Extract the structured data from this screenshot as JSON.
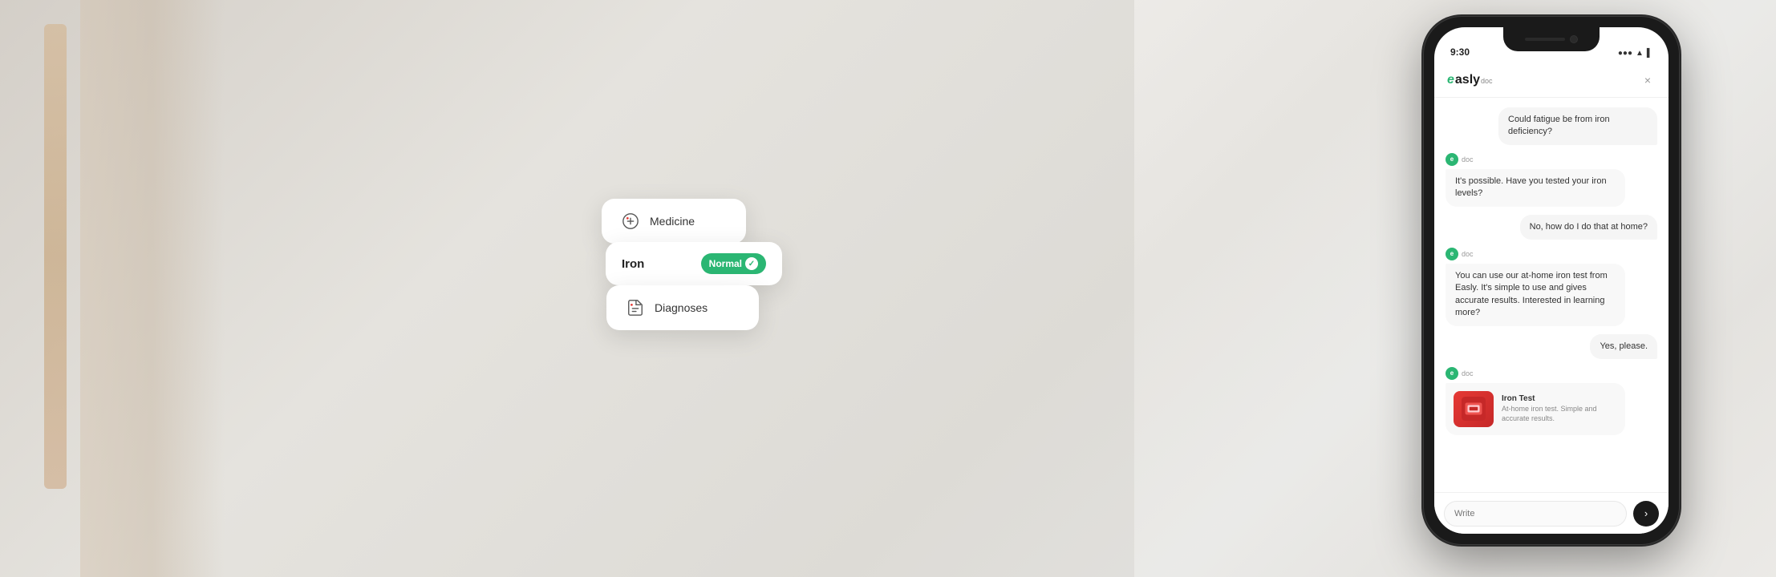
{
  "app": {
    "title": "easly.doc",
    "logo_e": "e",
    "logo_rest": "asly",
    "logo_doc": "doc",
    "close_label": "×"
  },
  "status_bar": {
    "time": "9:30",
    "signal": "●●●",
    "wifi": "▲",
    "battery": "▌"
  },
  "chat": {
    "messages": [
      {
        "type": "user",
        "text": "Could fatigue be from iron deficiency?"
      },
      {
        "type": "bot",
        "sender": "doc",
        "text": "It's possible. Have you tested your iron levels?"
      },
      {
        "type": "user",
        "text": "No, how do I do that at home?"
      },
      {
        "type": "bot",
        "sender": "doc",
        "text": "You can use our at-home iron test from Easly. It's simple to use and gives accurate results. Interested in learning more?"
      },
      {
        "type": "user",
        "text": "Yes, please."
      },
      {
        "type": "bot_product",
        "sender": "doc",
        "product_name": "Iron Test",
        "product_desc": "At-home iron test. Simple and accurate results."
      }
    ],
    "input_placeholder": "Write",
    "send_icon": "›"
  },
  "floating_cards": {
    "medicine": {
      "label": "Medicine",
      "icon": "⚕"
    },
    "iron": {
      "label": "Iron",
      "status": "Normal",
      "icon": "✓"
    },
    "diagnoses": {
      "label": "Diagnoses",
      "icon": "⚕"
    }
  },
  "colors": {
    "brand_green": "#2bb673",
    "dark": "#1a1a1a",
    "light_bg": "#f5f5f5",
    "card_bg": "#ffffff"
  }
}
